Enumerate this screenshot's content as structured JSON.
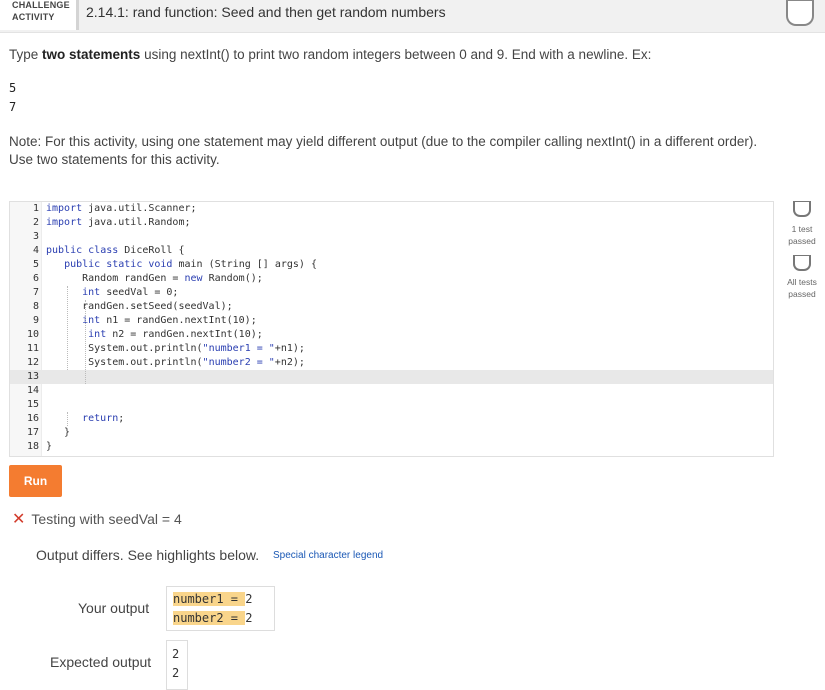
{
  "header": {
    "badge_line1": "CHALLENGE",
    "badge_line2": "ACTIVITY",
    "title": "2.14.1: rand function: Seed and then get random numbers"
  },
  "instructions": {
    "before": "Type ",
    "bold": "two statements",
    "after": " using nextInt() to print two random integers between 0 and 9. End with a newline. Ex:"
  },
  "example_output": [
    "5",
    "7"
  ],
  "note": {
    "line1": "Note: For this activity, using one statement may yield different output (due to the compiler calling nextInt() in a different order).",
    "line2": "Use two statements for this activity."
  },
  "code": [
    {
      "n": "1",
      "text": "import java.util.Scanner;"
    },
    {
      "n": "2",
      "text": "import java.util.Random;"
    },
    {
      "n": "3",
      "text": ""
    },
    {
      "n": "4",
      "text": "public class DiceRoll {"
    },
    {
      "n": "5",
      "text": "   public static void main (String [] args) {"
    },
    {
      "n": "6",
      "text": "      Random randGen = new Random();"
    },
    {
      "n": "7",
      "text": "      int seedVal = 0;"
    },
    {
      "n": "8",
      "text": "      randGen.setSeed(seedVal);"
    },
    {
      "n": "9",
      "text": "      int n1 = randGen.nextInt(10);"
    },
    {
      "n": "10",
      "text": "       int n2 = randGen.nextInt(10);"
    },
    {
      "n": "11",
      "text": "       System.out.println(\"number1 = \"+n1);"
    },
    {
      "n": "12",
      "text": "       System.out.println(\"number2 = \"+n2);"
    },
    {
      "n": "13",
      "text": ""
    },
    {
      "n": "14",
      "text": ""
    },
    {
      "n": "15",
      "text": ""
    },
    {
      "n": "16",
      "text": "      return;"
    },
    {
      "n": "17",
      "text": "   }"
    },
    {
      "n": "18",
      "text": "}"
    }
  ],
  "side": {
    "test1": "1 test passed",
    "all": "All tests passed"
  },
  "run_label": "Run",
  "result": {
    "testing": "Testing with seedVal = 4",
    "differs": "Output differs. See highlights below.",
    "legend": "Special character legend",
    "your_label": "Your output",
    "your_lines": [
      {
        "label": "number1",
        "eq": " = ",
        "val": "2"
      },
      {
        "label": "number2",
        "eq": " = ",
        "val": "2"
      }
    ],
    "expected_label": "Expected output",
    "expected_lines": [
      "2",
      "2"
    ]
  },
  "colors": {
    "accent": "#f47c30",
    "error": "#d23b2b",
    "highlight": "#f9d58b",
    "link": "#1a58b5"
  }
}
